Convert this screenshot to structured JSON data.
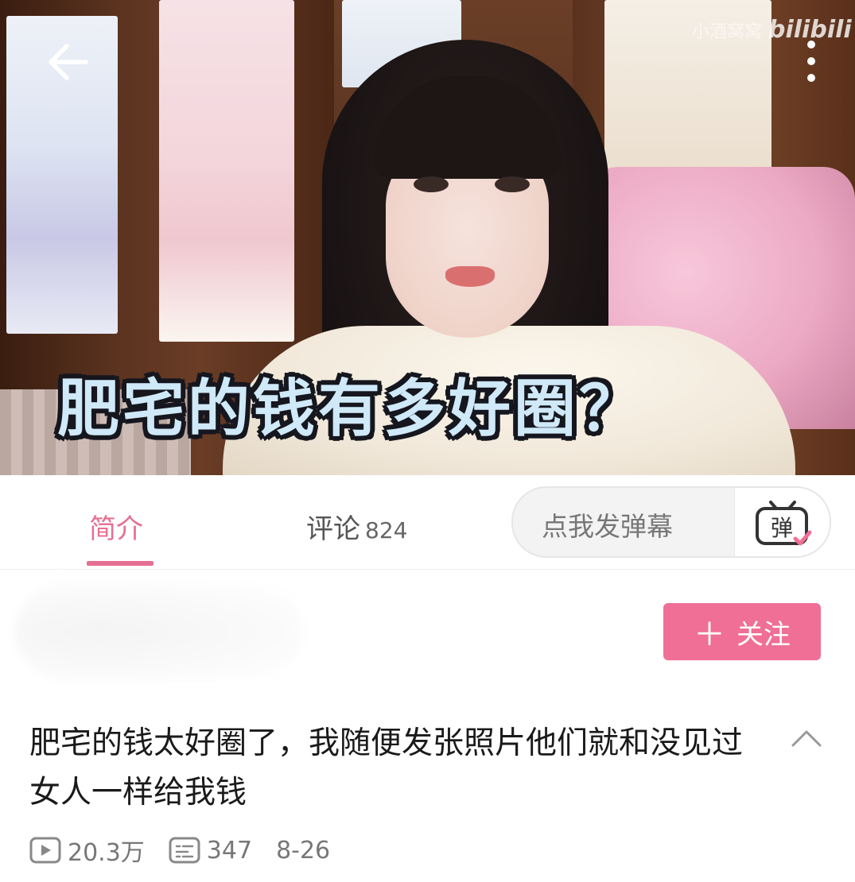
{
  "video": {
    "caption": "肥宅的钱有多好圈？",
    "watermark_user": "小酒窝窝",
    "watermark_brand": "bilibili"
  },
  "tabs": {
    "intro_label": "简介",
    "comments_label": "评论",
    "comments_count": "824"
  },
  "danmaku": {
    "placeholder": "点我发弹幕",
    "toggle_glyph": "弹"
  },
  "uploader": {
    "follow_label": "关注"
  },
  "info": {
    "title": "肥宅的钱太好圈了，我随便发张照片他们就和没见过女人一样给我钱",
    "views": "20.3万",
    "danmaku_count": "347",
    "date": "8-26"
  },
  "icons": [
    "back-arrow-icon",
    "more-vertical-icon",
    "danmaku-tv-icon",
    "plus-icon",
    "chevron-up-icon",
    "play-count-icon",
    "danmaku-count-icon"
  ],
  "colors": {
    "accent": "#f06f96",
    "tab_active": "#e56f92"
  }
}
